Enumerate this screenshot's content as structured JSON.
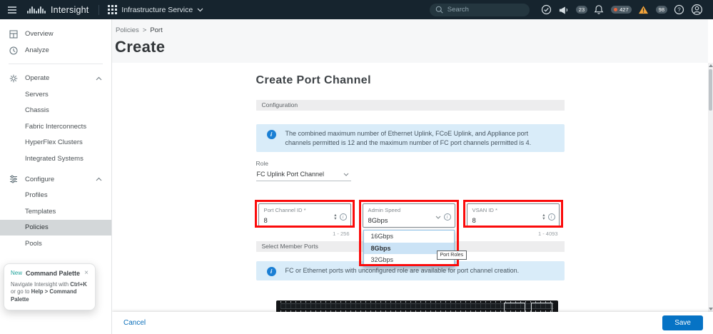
{
  "colors": {
    "topbar_bg": "#16242e",
    "accent_blue": "#0673c5",
    "info_icon_blue": "#1b7fd4",
    "info_alert_bg": "#d9ecf9",
    "annotation_red": "#fb0b0b",
    "selected_option_bg": "#cbe3f6",
    "selected_nav_bg": "#d3d7d9",
    "alarm_dot": "#e8653f",
    "warning_orange": "#f2a33a"
  },
  "icons": {
    "step_up": "▴",
    "step_down": "▾",
    "close": "×",
    "info_i": "i",
    "question_mark": "?"
  },
  "topbar": {
    "brand": "Intersight",
    "service_menu": "Infrastructure Service",
    "search_placeholder": "Search",
    "announce_count": "23",
    "alarm_count": "427",
    "warning_count": "98"
  },
  "breadcrumb": {
    "parent": "Policies",
    "separator": ">",
    "current": "Port"
  },
  "page": {
    "title": "Create"
  },
  "sidebar": {
    "items": [
      {
        "label": "Overview"
      },
      {
        "label": "Analyze"
      }
    ],
    "groups": [
      {
        "label": "Operate",
        "children": [
          "Servers",
          "Chassis",
          "Fabric Interconnects",
          "HyperFlex Clusters",
          "Integrated Systems"
        ]
      },
      {
        "label": "Configure",
        "children": [
          "Profiles",
          "Templates",
          "Policies",
          "Pools"
        ]
      }
    ],
    "selected": "Policies"
  },
  "command_palette": {
    "badge": "New",
    "title": "Command Palette",
    "text_prefix": "Navigate Intersight with ",
    "shortcut": "Ctrl+K",
    "text_mid": " or go to ",
    "menu_path": "Help > Command Palette"
  },
  "wizard": {
    "title": "Create Port Channel",
    "section_configuration": "Configuration",
    "section_member_ports": "Select Member Ports",
    "info_max_channels": "The combined maximum number of Ethernet Uplink, FCoE Uplink, and Appliance port channels permitted is 12 and the maximum number of FC port channels permitted is 4.",
    "info_member_ports": "FC or Ethernet ports with unconfigured role are available for port channel creation.",
    "role_label": "Role",
    "role_value": "FC Uplink Port Channel",
    "port_channel_id": {
      "label": "Port Channel ID *",
      "value": "8",
      "range": "1 - 256"
    },
    "admin_speed": {
      "label": "Admin Speed",
      "value": "8Gbps",
      "options": [
        "16Gbps",
        "8Gbps",
        "32Gbps"
      ],
      "selected": "8Gbps"
    },
    "vsan_id": {
      "label": "VSAN ID *",
      "value": "8",
      "range": "1 - 4093"
    },
    "port_roles_tooltip": "Port Roles"
  },
  "footer": {
    "cancel_label": "Cancel",
    "save_label": "Save"
  }
}
